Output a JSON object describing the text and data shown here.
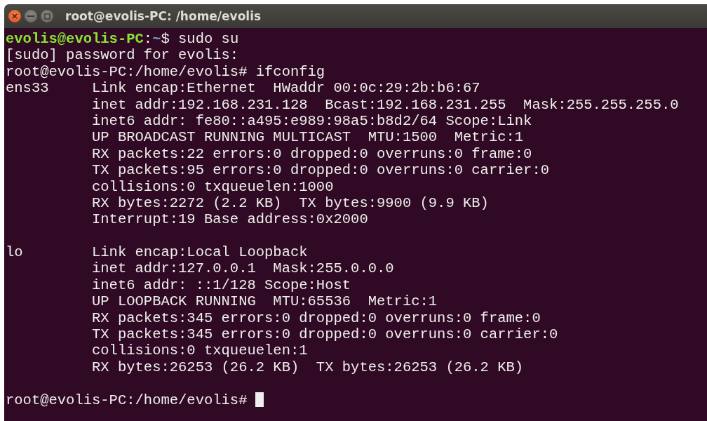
{
  "window": {
    "title": "root@evolis-PC: /home/evolis"
  },
  "lines": [
    {
      "kind": "prompt",
      "user_host": "evolis@evolis-PC",
      "separator": ":",
      "path": "~",
      "command": "$ sudo su"
    },
    {
      "kind": "output",
      "text": "[sudo] password for evolis:"
    },
    {
      "kind": "output",
      "text": "root@evolis-PC:/home/evolis# ifconfig"
    },
    {
      "kind": "output",
      "text": "ens33     Link encap:Ethernet  HWaddr 00:0c:29:2b:b6:67"
    },
    {
      "kind": "output",
      "text": "          inet addr:192.168.231.128  Bcast:192.168.231.255  Mask:255.255.255.0"
    },
    {
      "kind": "output",
      "text": "          inet6 addr: fe80::a495:e989:98a5:b8d2/64 Scope:Link"
    },
    {
      "kind": "output",
      "text": "          UP BROADCAST RUNNING MULTICAST  MTU:1500  Metric:1"
    },
    {
      "kind": "output",
      "text": "          RX packets:22 errors:0 dropped:0 overruns:0 frame:0"
    },
    {
      "kind": "output",
      "text": "          TX packets:95 errors:0 dropped:0 overruns:0 carrier:0"
    },
    {
      "kind": "output",
      "text": "          collisions:0 txqueuelen:1000"
    },
    {
      "kind": "output",
      "text": "          RX bytes:2272 (2.2 KB)  TX bytes:9900 (9.9 KB)"
    },
    {
      "kind": "output",
      "text": "          Interrupt:19 Base address:0x2000"
    },
    {
      "kind": "blank"
    },
    {
      "kind": "output",
      "text": "lo        Link encap:Local Loopback"
    },
    {
      "kind": "output",
      "text": "          inet addr:127.0.0.1  Mask:255.0.0.0"
    },
    {
      "kind": "output",
      "text": "          inet6 addr: ::1/128 Scope:Host"
    },
    {
      "kind": "output",
      "text": "          UP LOOPBACK RUNNING  MTU:65536  Metric:1"
    },
    {
      "kind": "output",
      "text": "          RX packets:345 errors:0 dropped:0 overruns:0 frame:0"
    },
    {
      "kind": "output",
      "text": "          TX packets:345 errors:0 dropped:0 overruns:0 carrier:0"
    },
    {
      "kind": "output",
      "text": "          collisions:0 txqueuelen:1"
    },
    {
      "kind": "output",
      "text": "          RX bytes:26253 (26.2 KB)  TX bytes:26253 (26.2 KB)"
    },
    {
      "kind": "blank"
    },
    {
      "kind": "output",
      "text": "root@evolis-PC:/home/evolis#",
      "cursor": true
    }
  ]
}
